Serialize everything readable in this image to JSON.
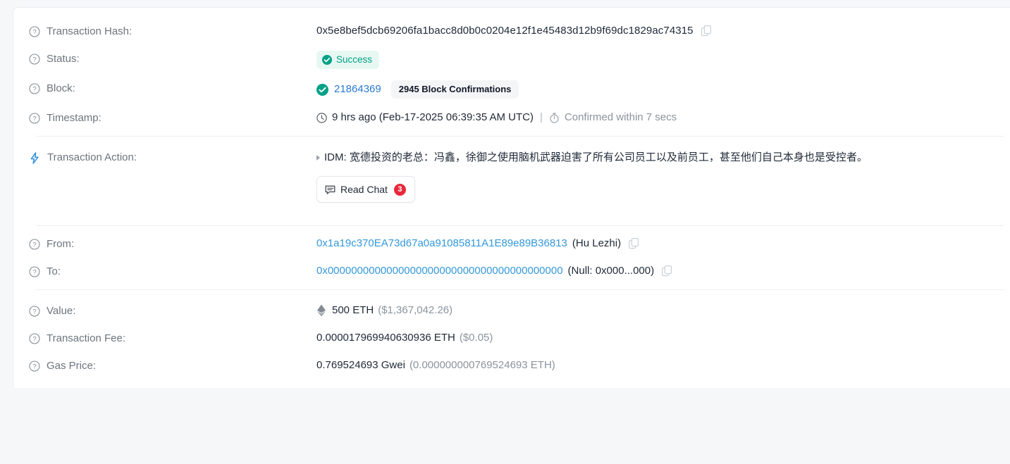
{
  "transaction": {
    "hash": {
      "label": "Transaction Hash:",
      "value": "0x5e8bef5dcb69206fa1bacc8d0b0c0204e12f1e45483d12b9f69dc1829ac74315",
      "copy_icon": "copy-icon"
    },
    "status": {
      "label": "Status:",
      "value": "Success",
      "icon": "check-circle-icon",
      "badge_bg": "#e7f8f2",
      "badge_color": "#00a186"
    },
    "block": {
      "label": "Block:",
      "number": "21864369",
      "confirmations": "2945 Block Confirmations",
      "icon": "check-circle-filled-icon"
    },
    "timestamp": {
      "label": "Timestamp:",
      "clock_icon": "clock-icon",
      "relative": "9 hrs ago",
      "absolute": "(Feb-17-2025 06:39:35 AM UTC)",
      "separator": "|",
      "stopwatch_icon": "stopwatch-icon",
      "confirmed": "Confirmed within 7 secs"
    },
    "action": {
      "label": "Transaction Action:",
      "icon": "lightning-bolt-icon",
      "caret": "caret-right-icon",
      "text": "IDM: 宽德投资的老总：冯鑫，徐御之使用脑机武器迫害了所有公司员工以及前员工，甚至他们自己本身也是受控者。",
      "read_chat_label": "Read Chat",
      "read_chat_count": "3",
      "chat_icon": "chat-bubble-icon"
    },
    "from": {
      "label": "From:",
      "address": "0x1a19c370EA73d67a0a91085811A1E89e89B36813",
      "name_tag": "(Hu Lezhi)",
      "copy_icon": "copy-icon"
    },
    "to": {
      "label": "To:",
      "address": "0x0000000000000000000000000000000000000000",
      "name_tag": "(Null: 0x000...000)",
      "copy_icon": "copy-icon"
    },
    "value": {
      "label": "Value:",
      "eth_icon": "ethereum-icon",
      "amount": "500 ETH",
      "usd": "($1,367,042.26)"
    },
    "fee": {
      "label": "Transaction Fee:",
      "amount": "0.000017969940630936 ETH",
      "usd": "($0.05)"
    },
    "gas_price": {
      "label": "Gas Price:",
      "gwei": "0.769524693 Gwei",
      "eth": "(0.000000000769524693 ETH)"
    }
  },
  "theme": {
    "link_color": "#2a7ad2",
    "address_color": "#3498db",
    "success_color": "#00a186",
    "badge_red": "#e8283b",
    "muted_color": "#8b949e",
    "label_color": "#6c757d",
    "page_bg": "#f6f7f9",
    "card_bg": "#ffffff"
  }
}
